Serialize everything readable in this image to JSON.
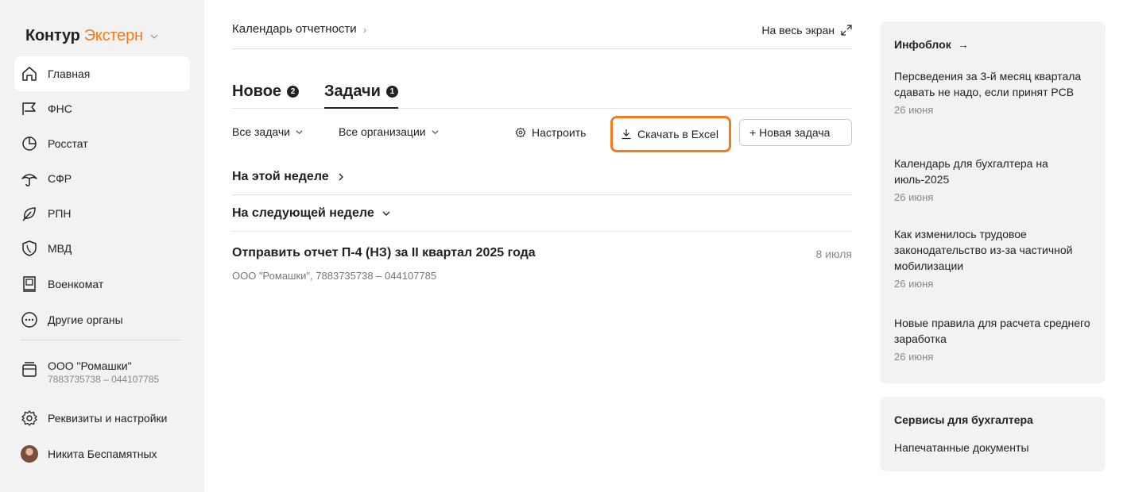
{
  "sidebar": {
    "brand": {
      "part1": "Контур",
      "part2": "Экстерн"
    },
    "items": [
      {
        "label": "Главная",
        "icon": "home-icon"
      },
      {
        "label": "ФНС",
        "icon": "flag-icon"
      },
      {
        "label": "Росстат",
        "icon": "pie-chart-icon"
      },
      {
        "label": "СФР",
        "icon": "umbrella-icon"
      },
      {
        "label": "РПН",
        "icon": "leaf-icon"
      },
      {
        "label": "МВД",
        "icon": "shield-icon"
      },
      {
        "label": "Военкомат",
        "icon": "id-card-icon"
      },
      {
        "label": "Другие органы",
        "icon": "more-icon"
      }
    ],
    "org": {
      "name": "ООО \"Ромашки\"",
      "inn": "7883735738 – 044107785"
    },
    "settings_label": "Реквизиты и настройки",
    "user_name": "Никита Беспамятных"
  },
  "header": {
    "breadcrumb": "Календарь отчетности",
    "fullscreen_label": "На весь экран"
  },
  "tabs": [
    {
      "label": "Новое",
      "badge": "2"
    },
    {
      "label": "Задачи",
      "badge": "1"
    }
  ],
  "toolbar": {
    "filter_tasks": "Все задачи",
    "filter_orgs": "Все организации",
    "configure_label": "Настроить",
    "excel_label": "Скачать в Excel",
    "new_task_label": "+ Новая задача"
  },
  "sections": {
    "this_week": "На этой неделе",
    "next_week": "На следующей неделе"
  },
  "task": {
    "title": "Отправить отчет П-4 (НЗ) за II квартал 2025 года",
    "date": "8 июля",
    "org": "ООО \"Ромашки\", 7883735738 – 044107785"
  },
  "infoblock": {
    "title": "Инфоблок",
    "news": [
      {
        "title": "Персведения за 3-й месяц квартала сдавать не надо, если принят РСВ",
        "date": "26 июня"
      },
      {
        "title": "Календарь для бухгалтера на июль-2025",
        "date": "26 июня"
      },
      {
        "title": "Как изменилось трудовое законодательство из-за частичной мобилизации",
        "date": "26 июня"
      },
      {
        "title": "Новые правила для расчета среднего заработка",
        "date": "26 июня"
      }
    ]
  },
  "services": {
    "title": "Сервисы для бухгалтера",
    "link": "Напечатанные документы"
  },
  "colors": {
    "accent": "#f47a20",
    "highlight_border": "#f27a21",
    "sidebar_bg": "#f2f2f2"
  }
}
